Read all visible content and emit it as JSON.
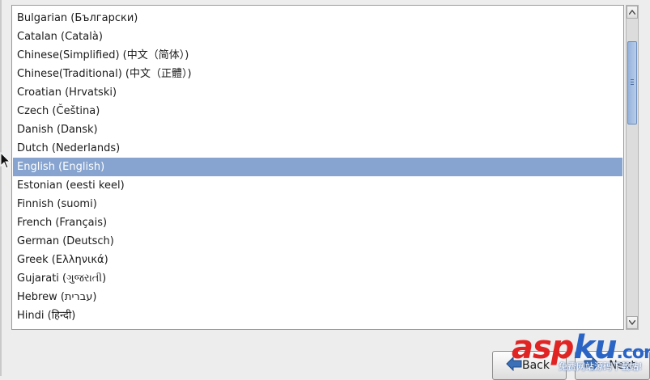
{
  "languages": {
    "items": [
      {
        "label": "Bulgarian (Български)",
        "selected": false
      },
      {
        "label": "Catalan (Català)",
        "selected": false
      },
      {
        "label": "Chinese(Simplified) (中文（简体）)",
        "selected": false
      },
      {
        "label": "Chinese(Traditional) (中文（正體）)",
        "selected": false
      },
      {
        "label": "Croatian (Hrvatski)",
        "selected": false
      },
      {
        "label": "Czech (Čeština)",
        "selected": false
      },
      {
        "label": "Danish (Dansk)",
        "selected": false
      },
      {
        "label": "Dutch (Nederlands)",
        "selected": false
      },
      {
        "label": "English (English)",
        "selected": true
      },
      {
        "label": "Estonian (eesti keel)",
        "selected": false
      },
      {
        "label": "Finnish (suomi)",
        "selected": false
      },
      {
        "label": "French (Français)",
        "selected": false
      },
      {
        "label": "German (Deutsch)",
        "selected": false
      },
      {
        "label": "Greek (Ελληνικά)",
        "selected": false
      },
      {
        "label": "Gujarati (ગુજરાતી)",
        "selected": false
      },
      {
        "label": "Hebrew (עברית)",
        "selected": false
      },
      {
        "label": "Hindi (हिन्दी)",
        "selected": false
      }
    ]
  },
  "buttons": {
    "back_label": "Back",
    "next_label": "Next"
  },
  "watermark": {
    "brand_a": "asp",
    "brand_b": "ku",
    "brand_c": ".com",
    "subtitle": "免费网站源码下载站!"
  },
  "colors": {
    "selection": "#86a4cf",
    "scroll_thumb": "#95b3db",
    "watermark_red": "#e02424",
    "watermark_blue": "#2a64c4"
  }
}
